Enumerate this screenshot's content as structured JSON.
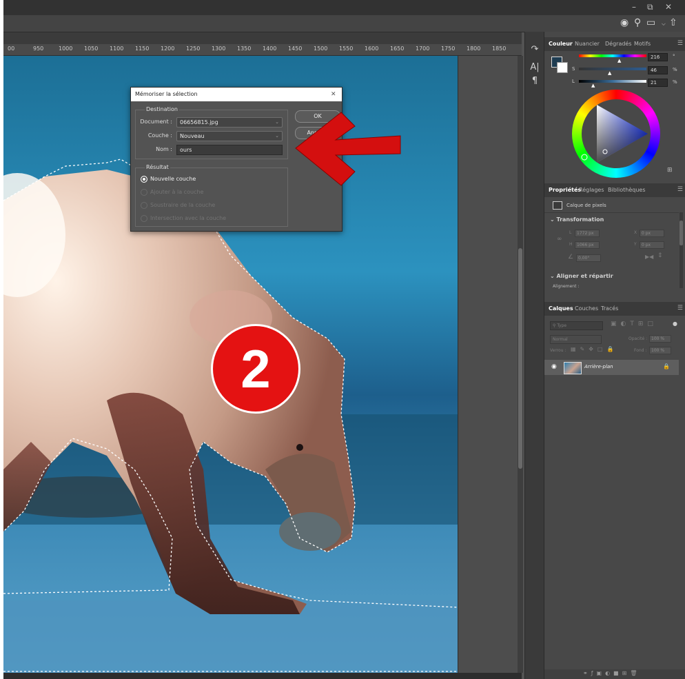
{
  "ruler": {
    "ticks": [
      "00",
      "950",
      "1000",
      "1050",
      "1100",
      "1150",
      "1200",
      "1250",
      "1300",
      "1350",
      "1400",
      "1450",
      "1500",
      "1550",
      "1600",
      "1650",
      "1700",
      "1750",
      "1800",
      "1850"
    ]
  },
  "window": {
    "minimize": "–",
    "restore": "⧉",
    "close": "✕"
  },
  "color_panel": {
    "tabs": [
      "Couleur",
      "Nuancier",
      "Dégradés",
      "Motifs"
    ],
    "sliders": [
      {
        "label": "",
        "value": "216",
        "unit": "°",
        "level": 0.6
      },
      {
        "label": "S",
        "value": "46",
        "unit": "%",
        "level": 0.46
      },
      {
        "label": "L",
        "value": "21",
        "unit": "%",
        "level": 0.21
      }
    ],
    "foreground": "#1f3d52"
  },
  "properties_panel": {
    "tabs": [
      "Propriétés",
      "Réglages",
      "Bibliothèques"
    ],
    "layer_type": "Calque de pixels",
    "section_transform": "Transformation",
    "w_label": "L",
    "w_value": "1772 px",
    "h_label": "H",
    "h_value": "1066 px",
    "x_label": "X",
    "x_value": "0 px",
    "y_label": "Y",
    "y_value": "0 px",
    "angle_value": "0,00°",
    "section_align": "Aligner et répartir",
    "align_label": "Alignement :"
  },
  "layers_panel": {
    "tabs": [
      "Calques",
      "Couches",
      "Tracés"
    ],
    "search_placeholder": "Type",
    "blend_mode": "Normal",
    "opacity_label": "Opacité :",
    "opacity_value": "100 %",
    "lock_label": "Verrou :",
    "fill_label": "Fond :",
    "fill_value": "100 %",
    "layers": [
      {
        "name": "Arrière-plan"
      }
    ]
  },
  "dialog": {
    "title": "Mémoriser la sélection",
    "destination_label": "Destination",
    "document_label": "Document :",
    "document_value": "06656815.jpg",
    "channel_label": "Couche :",
    "channel_value": "Nouveau",
    "name_label": "Nom :",
    "name_value": "ours",
    "ok_label": "OK",
    "cancel_label": "Annuler",
    "result_label": "Résultat",
    "options": [
      {
        "label": "Nouvelle couche",
        "selected": true,
        "enabled": true
      },
      {
        "label": "Ajouter à la couche",
        "selected": false,
        "enabled": false
      },
      {
        "label": "Soustraire de la couche",
        "selected": false,
        "enabled": false
      },
      {
        "label": "Intersection avec la couche",
        "selected": false,
        "enabled": false
      }
    ]
  },
  "annotation": {
    "badge_number": "2",
    "arrow_color": "#d40f0f"
  }
}
